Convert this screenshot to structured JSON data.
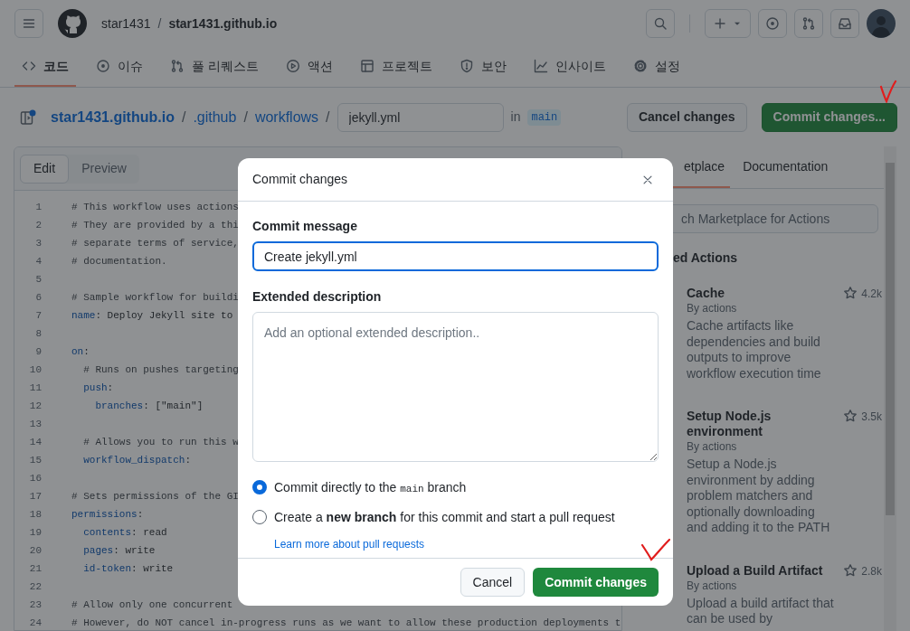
{
  "header": {
    "owner": "star1431",
    "separator": "/",
    "repo": "star1431.github.io"
  },
  "nav_tabs": [
    {
      "label": "코드",
      "selected": true
    },
    {
      "label": "이슈",
      "selected": false
    },
    {
      "label": "풀 리퀘스트",
      "selected": false
    },
    {
      "label": "액션",
      "selected": false
    },
    {
      "label": "프로젝트",
      "selected": false
    },
    {
      "label": "보안",
      "selected": false
    },
    {
      "label": "인사이트",
      "selected": false
    },
    {
      "label": "설정",
      "selected": false
    }
  ],
  "breadcrumb": {
    "repo": "star1431.github.io",
    "separator": "/",
    "folders": [
      ".github",
      "workflows"
    ],
    "filename": "jekyll.yml",
    "branch_prefix": "in",
    "branch": "main"
  },
  "actions": {
    "cancel": "Cancel changes",
    "commit": "Commit changes..."
  },
  "editor": {
    "tabs": [
      {
        "label": "Edit",
        "selected": true
      },
      {
        "label": "Preview",
        "selected": false
      }
    ],
    "lines": [
      {
        "number": "1",
        "segments": [
          {
            "kind": "comment",
            "text": "# This workflow uses actions"
          }
        ]
      },
      {
        "number": "2",
        "segments": [
          {
            "kind": "comment",
            "text": "# They are provided by a thi"
          }
        ]
      },
      {
        "number": "3",
        "segments": [
          {
            "kind": "comment",
            "text": "# separate terms of service,"
          }
        ]
      },
      {
        "number": "4",
        "segments": [
          {
            "kind": "comment",
            "text": "# documentation."
          }
        ]
      },
      {
        "number": "5"
      },
      {
        "number": "6",
        "segments": [
          {
            "kind": "comment",
            "text": "# Sample workflow for buildi"
          }
        ]
      },
      {
        "number": "7",
        "segments": [
          {
            "kind": "key",
            "text": "name"
          },
          {
            "kind": "plain",
            "text": ": Deploy Jekyll site to"
          }
        ]
      },
      {
        "number": "8"
      },
      {
        "number": "9",
        "segments": [
          {
            "kind": "key",
            "text": "on"
          },
          {
            "kind": "plain",
            "text": ":"
          }
        ]
      },
      {
        "number": "10",
        "segments": [
          {
            "kind": "comment",
            "text": "  # Runs on pushes targeting"
          }
        ]
      },
      {
        "number": "11",
        "segments": [
          {
            "kind": "key",
            "text": "  push"
          },
          {
            "kind": "plain",
            "text": ":"
          }
        ]
      },
      {
        "number": "12",
        "segments": [
          {
            "kind": "key",
            "text": "    branches"
          },
          {
            "kind": "plain",
            "text": ": [\"main\"]"
          }
        ]
      },
      {
        "number": "13"
      },
      {
        "number": "14",
        "segments": [
          {
            "kind": "comment",
            "text": "  # Allows you to run this w"
          }
        ]
      },
      {
        "number": "15",
        "segments": [
          {
            "kind": "key",
            "text": "  workflow_dispatch"
          },
          {
            "kind": "plain",
            "text": ":"
          }
        ]
      },
      {
        "number": "16"
      },
      {
        "number": "17",
        "segments": [
          {
            "kind": "comment",
            "text": "# Sets permissions of the GI"
          }
        ]
      },
      {
        "number": "18",
        "segments": [
          {
            "kind": "key",
            "text": "permissions"
          },
          {
            "kind": "plain",
            "text": ":"
          }
        ]
      },
      {
        "number": "19",
        "segments": [
          {
            "kind": "key",
            "text": "  contents"
          },
          {
            "kind": "plain",
            "text": ": read"
          }
        ]
      },
      {
        "number": "20",
        "segments": [
          {
            "kind": "key",
            "text": "  pages"
          },
          {
            "kind": "plain",
            "text": ": write"
          }
        ]
      },
      {
        "number": "21",
        "segments": [
          {
            "kind": "key",
            "text": "  id-token"
          },
          {
            "kind": "plain",
            "text": ": write"
          }
        ]
      },
      {
        "number": "22"
      },
      {
        "number": "23",
        "segments": [
          {
            "kind": "comment",
            "text": "# Allow only one concurrent"
          }
        ]
      },
      {
        "number": "24",
        "segments": [
          {
            "kind": "comment",
            "text": "# However, do NOT cancel in-progress runs as we want to allow these production deployments t"
          }
        ]
      }
    ]
  },
  "side_panel": {
    "tabs": [
      {
        "label": "etplace",
        "selected": true
      },
      {
        "label": "Documentation",
        "selected": false
      }
    ],
    "search_placeholder": "ch Marketplace for Actions",
    "heading": "ed Actions",
    "items": [
      {
        "name": "Cache",
        "author": "By actions",
        "description": "Cache artifacts like dependencies and build outputs to improve workflow execution time",
        "star_count": "4.2k"
      },
      {
        "name": "Setup Node.js environment",
        "author": "By actions",
        "description": "Setup a Node.js environment by adding problem matchers and optionally downloading and adding it to the PATH",
        "star_count": "3.5k"
      },
      {
        "name": "Upload a Build Artifact",
        "author": "By actions",
        "description": "Upload a build artifact that can be used by",
        "star_count": "2.8k"
      }
    ]
  },
  "dialog": {
    "title": "Commit changes",
    "message_label": "Commit message",
    "message_value": "Create jekyll.yml",
    "description_label": "Extended description",
    "description_placeholder": "Add an optional extended description..",
    "options": [
      {
        "kind": "direct",
        "selected": true,
        "before": "Commit directly to the ",
        "code": "main",
        "after": " branch"
      },
      {
        "kind": "branch",
        "selected": false,
        "text": "Create a **new branch** for this commit and start a pull request",
        "link": "Learn more about pull requests"
      }
    ],
    "cancel": "Cancel",
    "confirm": "Commit changes"
  }
}
